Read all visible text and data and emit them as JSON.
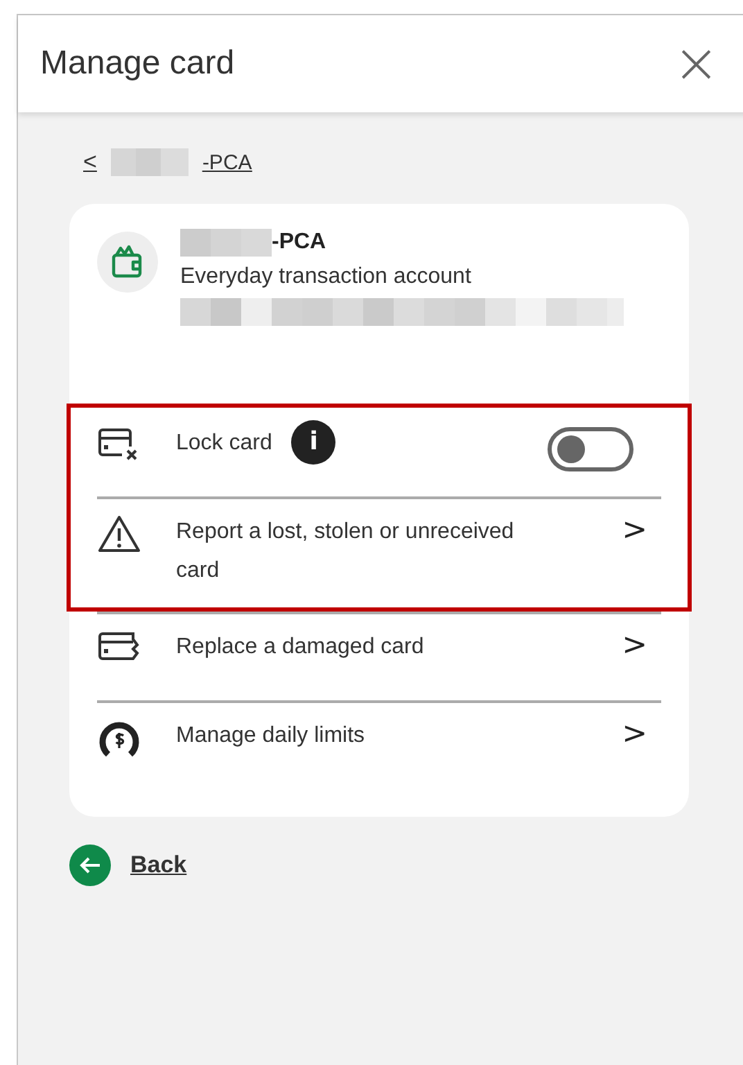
{
  "dialog": {
    "title": "Manage card",
    "close": "×"
  },
  "breadcrumb": {
    "chevron": "<",
    "label": "-PCA"
  },
  "account": {
    "name": "-PCA",
    "type": "Everyday transaction account"
  },
  "actions": [
    {
      "kind": "toggle",
      "label": "Lock card",
      "info": "i",
      "on": false,
      "highlighted": true
    },
    {
      "kind": "link",
      "label": "Report a lost, stolen or unreceived card",
      "chevron": ">",
      "highlighted": true
    },
    {
      "kind": "link",
      "label": "Replace a damaged card",
      "chevron": ">",
      "highlighted": false
    },
    {
      "kind": "link",
      "label": "Manage daily limits",
      "chevron": ">",
      "highlighted": false
    }
  ],
  "back": {
    "label": "Back"
  }
}
